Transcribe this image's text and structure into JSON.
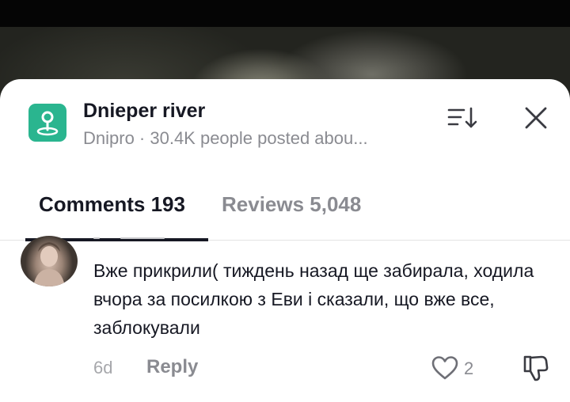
{
  "place": {
    "title": "Dnieper river",
    "subtitle": "Dnipro · 30.4K people posted abou...",
    "icon": "location-pin-icon",
    "accent_color": "#2ab58f"
  },
  "header_actions": {
    "sort_icon": "sort-icon",
    "close_icon": "close-icon"
  },
  "tabs": [
    {
      "label": "Comments 193",
      "active": true
    },
    {
      "label": "Reviews 5,048",
      "active": false
    }
  ],
  "comment": {
    "text": "Вже прикрили( тиждень назад ще забирала, ходила вчора за посилкою з Еви і сказали, що вже все, заблокували",
    "time": "6d",
    "reply_label": "Reply",
    "like_count": "2",
    "like_icon": "heart-icon",
    "dislike_icon": "thumbs-down-icon"
  }
}
